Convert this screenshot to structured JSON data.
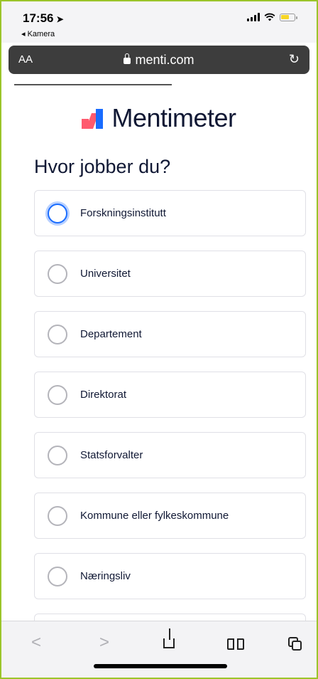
{
  "status_bar": {
    "time": "17:56",
    "back_app": "Kamera"
  },
  "browser": {
    "aa": "AA",
    "url": "menti.com"
  },
  "logo": {
    "text": "Mentimeter"
  },
  "question": "Hvor jobber du?",
  "options": [
    {
      "label": "Forskningsinstitutt",
      "focused": true
    },
    {
      "label": "Universitet"
    },
    {
      "label": "Departement"
    },
    {
      "label": "Direktorat"
    },
    {
      "label": "Statsforvalter"
    },
    {
      "label": "Kommune eller fylkeskommune"
    },
    {
      "label": "Næringsliv"
    }
  ],
  "toolbar": {
    "back_icon": "chevron-left-icon",
    "forward_icon": "chevron-right-icon",
    "share_icon": "share-icon",
    "bookmarks_icon": "book-icon",
    "tabs_icon": "tabs-icon"
  },
  "colors": {
    "accent": "#196cff",
    "brand_red": "#ff5a6e",
    "text": "#101834"
  }
}
